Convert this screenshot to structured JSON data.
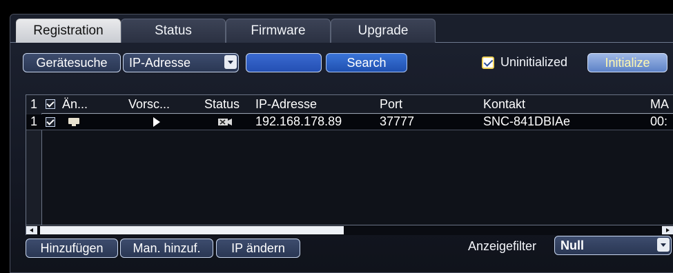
{
  "tabs": [
    {
      "label": "Registration",
      "active": true
    },
    {
      "label": "Status",
      "active": false
    },
    {
      "label": "Firmware",
      "active": false
    },
    {
      "label": "Upgrade",
      "active": false
    }
  ],
  "toolbar": {
    "search_device_label": "Gerätesuche",
    "filter_type_value": "IP-Adresse",
    "search_text_value": "",
    "search_button_label": "Search",
    "uninitialized_label": "Uninitialized",
    "uninitialized_checked": true,
    "initialize_button_label": "Initialize"
  },
  "table": {
    "columns": [
      "Än...",
      "Vorsc...",
      "Status",
      "IP-Adresse",
      "Port",
      "Kontakt",
      "MA"
    ],
    "header_index": "1",
    "rows": [
      {
        "index": "1",
        "checked": true,
        "status_icon": "camera-offline-icon",
        "ip": "192.168.178.89",
        "port": "37777",
        "kontakt": "SNC-841DBIAe",
        "mac": "00:"
      }
    ],
    "scroll_position": 0.45
  },
  "bottom": {
    "add_label": "Hinzufügen",
    "manual_add_label": "Man. hinzuf.",
    "change_ip_label": "IP ändern",
    "display_filter_label": "Anzeigefilter",
    "display_filter_value": "Null"
  },
  "colors": {
    "accent_blue": "#2450b3",
    "checkbox_border": "#f2d45c",
    "panel_bg": "#141824"
  }
}
